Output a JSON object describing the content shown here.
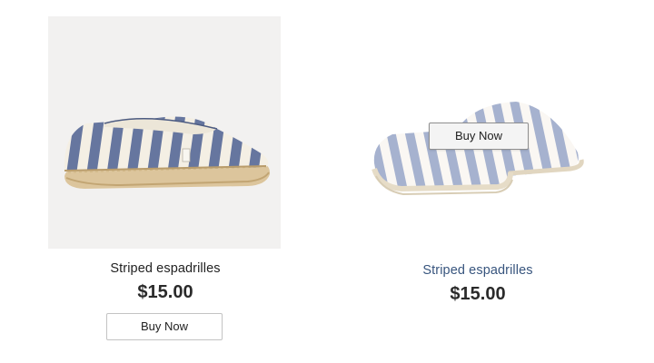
{
  "products": [
    {
      "title": "Striped espadrilles",
      "price": "$15.00",
      "button_label": "Buy Now",
      "image_alt": "Striped espadrilles"
    },
    {
      "title": "Striped espadrilles",
      "price": "$15.00",
      "button_label": "Buy Now",
      "image_alt": "Striped espadrilles",
      "state": "hover"
    }
  ],
  "colors": {
    "title_hover": "#38557e",
    "stripe_blue": "#6f7fa6",
    "stripe_cream": "#f4efe4",
    "jute_sole": "#d9c196"
  }
}
